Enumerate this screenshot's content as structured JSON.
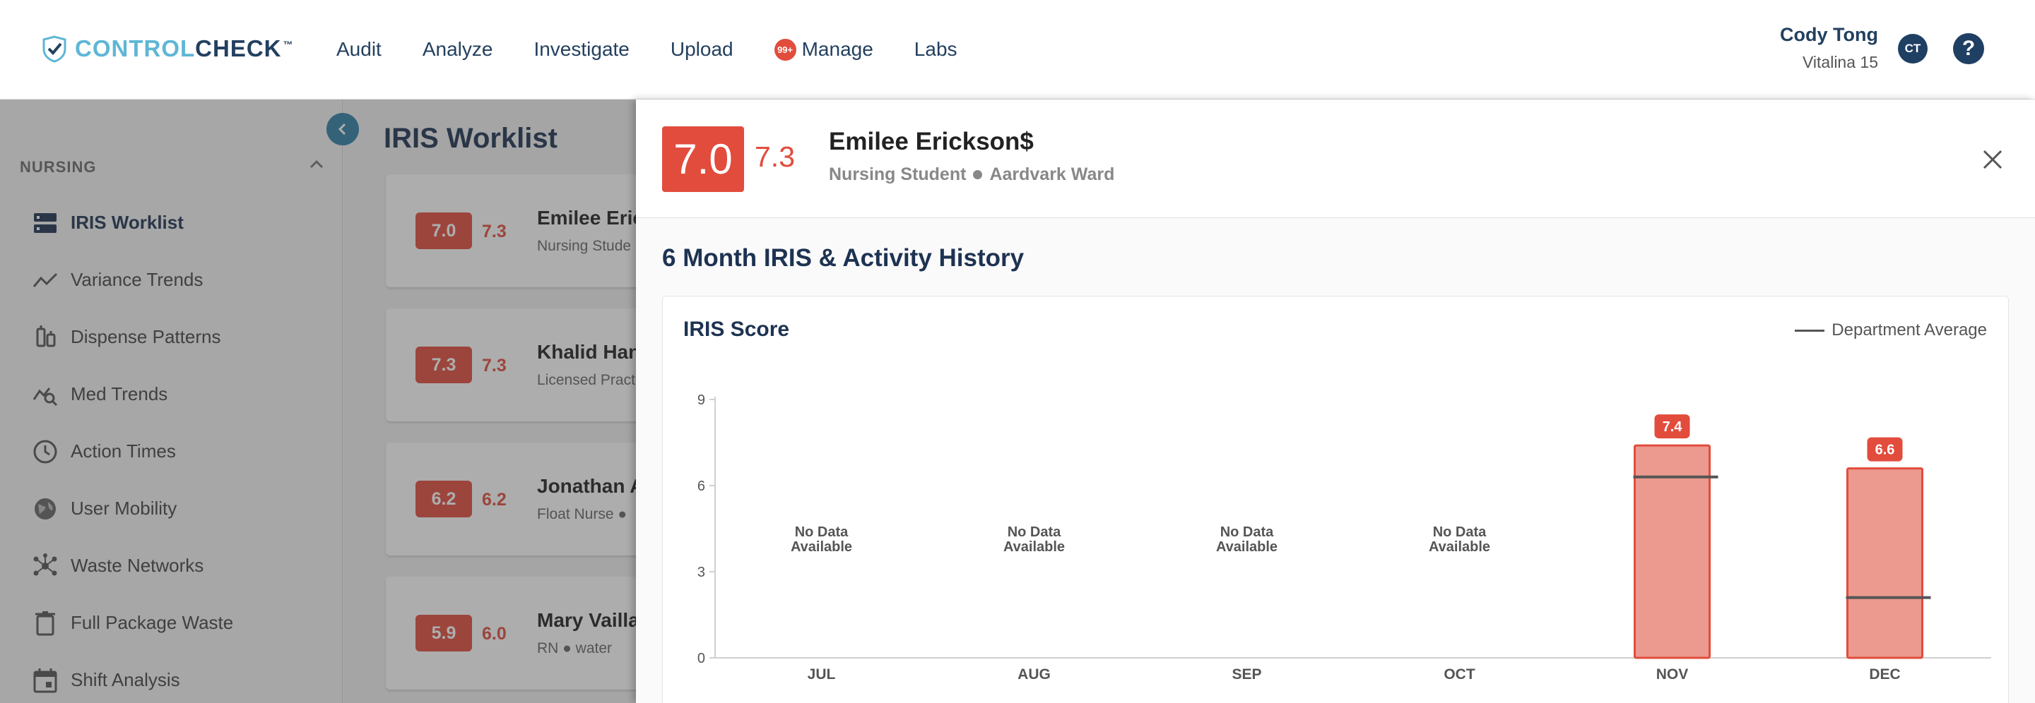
{
  "brand": {
    "name_part1": "CONTROL",
    "name_part2": "CHECK",
    "tm": "™"
  },
  "nav": {
    "items": [
      {
        "label": "Audit"
      },
      {
        "label": "Analyze"
      },
      {
        "label": "Investigate"
      },
      {
        "label": "Upload"
      },
      {
        "label": "Manage",
        "badge": "99+"
      },
      {
        "label": "Labs"
      }
    ]
  },
  "user": {
    "name": "Cody Tong",
    "location": "Vitalina 15",
    "initials": "CT",
    "help": "?"
  },
  "sidebar": {
    "section": "NURSING",
    "items": [
      {
        "label": "IRIS Worklist",
        "active": true
      },
      {
        "label": "Variance Trends"
      },
      {
        "label": "Dispense Patterns"
      },
      {
        "label": "Med Trends"
      },
      {
        "label": "Action Times"
      },
      {
        "label": "User Mobility"
      },
      {
        "label": "Waste Networks"
      },
      {
        "label": "Full Package Waste"
      },
      {
        "label": "Shift Analysis"
      }
    ]
  },
  "worklist": {
    "title": "IRIS Worklist",
    "cards": [
      {
        "score": "7.0",
        "score2": "7.3",
        "name": "Emilee Eric",
        "sub": "Nursing Stude"
      },
      {
        "score": "7.3",
        "score2": "7.3",
        "name": "Khalid Han",
        "sub": "Licensed Pract"
      },
      {
        "score": "6.2",
        "score2": "6.2",
        "name": "Jonathan A",
        "sub": "Float Nurse ●"
      },
      {
        "score": "5.9",
        "score2": "6.0",
        "name": "Mary Vailla",
        "sub": "RN ● water"
      }
    ]
  },
  "panel": {
    "score": "7.0",
    "score2": "7.3",
    "name": "Emilee Erickson$",
    "role": "Nursing Student",
    "ward": "Aardvark Ward",
    "history_title": "6 Month IRIS & Activity History"
  },
  "chart_data": {
    "type": "bar",
    "title": "IRIS Score",
    "legend": "Department Average",
    "legend_placement": "top-right",
    "categories": [
      "JUL",
      "AUG",
      "SEP",
      "OCT",
      "NOV",
      "DEC"
    ],
    "values": [
      null,
      null,
      null,
      null,
      7.4,
      6.6
    ],
    "value_labels": [
      "",
      "",
      "",
      "",
      "7.4",
      "6.6"
    ],
    "department_average": [
      null,
      null,
      null,
      null,
      6.3,
      2.1
    ],
    "no_data_label": [
      "No Data",
      "Available"
    ],
    "yticks": [
      "9",
      "6",
      "3",
      "0"
    ],
    "ylim": [
      0,
      9
    ],
    "colors": {
      "bar_fill": "#ec9a8f",
      "bar_stroke": "#e24c3d",
      "avg_line": "#555555",
      "label_bg": "#e24c3d"
    }
  }
}
